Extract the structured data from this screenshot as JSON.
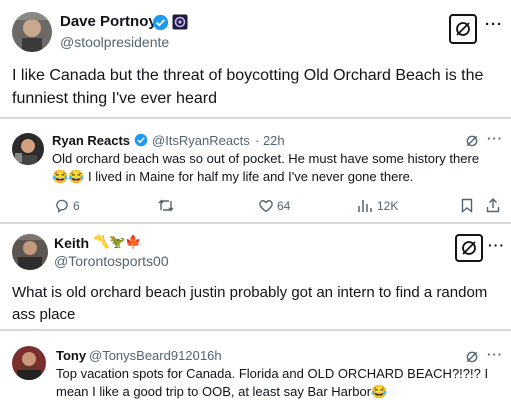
{
  "tweet1": {
    "name": "Dave Portnoy",
    "handle": "@stoolpresidente",
    "text_line1": "I like Canada but the threat of boycotting Old Orchard Beach is the",
    "text_line2": "funniest thing I've ever heard"
  },
  "tweet2": {
    "name": "Ryan Reacts",
    "handle": "@ItsRyanReacts",
    "time": "· 22h",
    "text_line1": "Old orchard beach was so out of pocket. He must have some history there",
    "text_line2_emoji": "😂😂",
    "text_line2": "I lived in Maine for half my life and I've never gone there.",
    "replies": "6",
    "likes": "64",
    "views": "12K"
  },
  "tweet3": {
    "name": "Keith",
    "name_emojis": "〽️🦖🍁",
    "handle": "@Torontosports00",
    "text_line1": "What is old orchard beach justin probably got an intern to find a random",
    "text_line2": "ass place"
  },
  "tweet4": {
    "name": "Tony",
    "handle": "@TonysBeard9120",
    "time": "· 16h",
    "text_line1": "Top vacation spots for Canada. Florida and OLD ORCHARD BEACH?!?!? I",
    "text_line2": "mean I like a good trip to OOB, at least say Bar Harbor",
    "text_line2_emoji": "😂"
  },
  "more_label": "···",
  "colors": {
    "verified": "#1d9bf0",
    "secondary": "#536471",
    "text": "#0f1419",
    "divider": "#d9d9d9"
  }
}
